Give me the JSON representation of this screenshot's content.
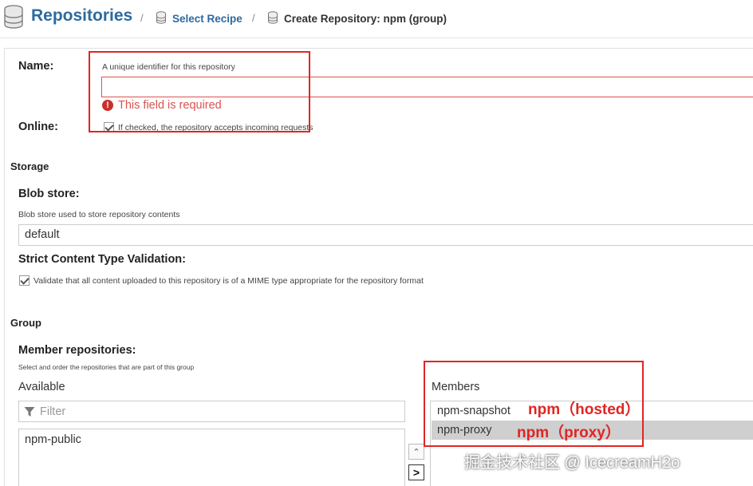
{
  "breadcrumb": {
    "title": "Repositories",
    "separator": "/",
    "link": "Select Recipe",
    "current": "Create Repository: npm (group)"
  },
  "form": {
    "name_label": "Name:",
    "name_help": "A unique identifier for this repository",
    "name_value": "",
    "name_error": "This field is required",
    "online_label": "Online:",
    "online_checked": true,
    "online_help": "If checked, the repository accepts incoming requests",
    "storage_section": "Storage",
    "blob_label": "Blob store:",
    "blob_help": "Blob store used to store repository contents",
    "blob_value": "default",
    "strict_label": "Strict Content Type Validation:",
    "strict_checked": true,
    "strict_help": "Validate that all content uploaded to this repository is of a MIME type appropriate for the repository format",
    "group_section": "Group",
    "members_label": "Member repositories:",
    "members_help": "Select and order the repositories that are part of this group",
    "available_head": "Available",
    "filter_placeholder": "Filter",
    "available_items": [
      "npm-public"
    ],
    "members_head": "Members",
    "member_items": [
      "npm-snapshot",
      "npm-proxy"
    ],
    "selected_member": "npm-proxy"
  },
  "annotations": {
    "hosted": "npm（hosted）",
    "proxy": "npm（proxy）",
    "color": "#e02525"
  },
  "watermark": "掘金技术社区 @ IcecreamH2o",
  "colors": {
    "accent": "#2c6aa0",
    "error": "#d9534f"
  }
}
